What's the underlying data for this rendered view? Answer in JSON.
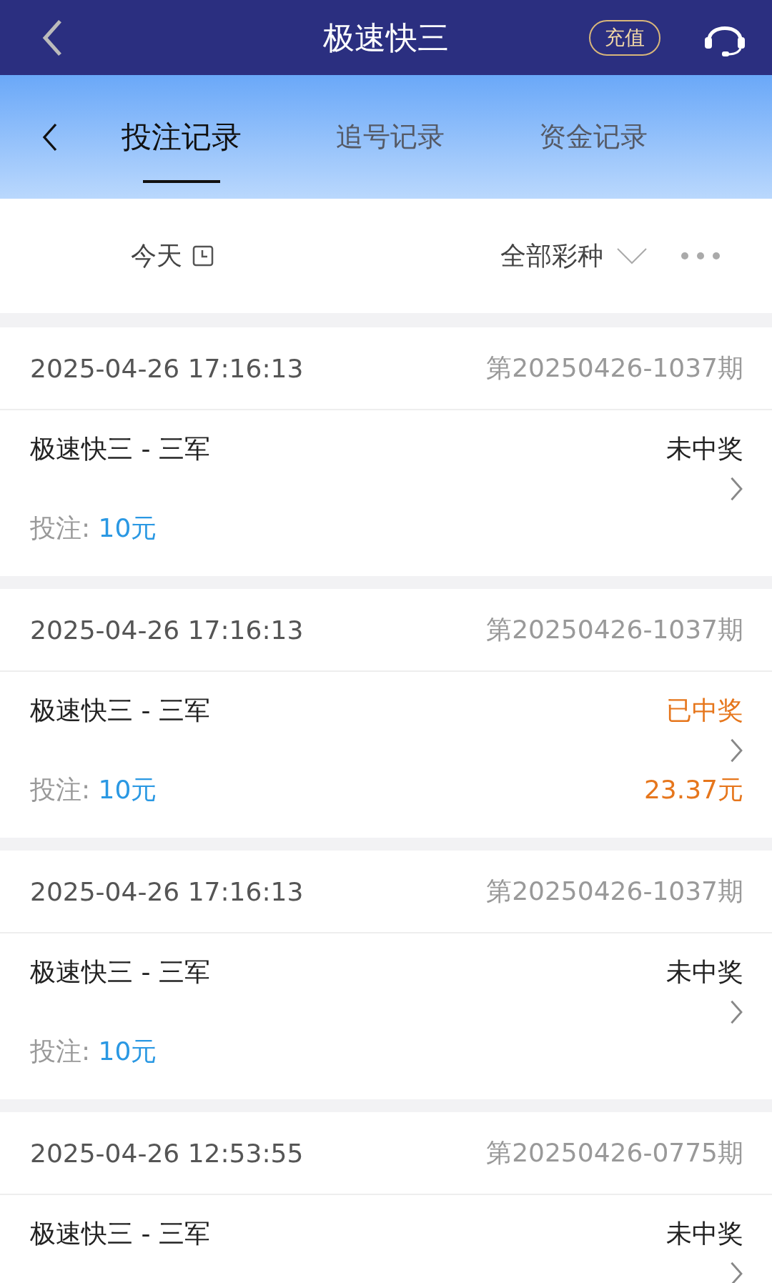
{
  "header": {
    "title": "极速快三",
    "recharge": "充值"
  },
  "tabs": [
    {
      "label": "投注记录",
      "selected": true
    },
    {
      "label": "追号记录",
      "selected": false
    },
    {
      "label": "资金记录",
      "selected": false
    }
  ],
  "filters": {
    "date": "今天",
    "lottery": "全部彩种"
  },
  "records": [
    {
      "time": "2025-04-26 17:16:13",
      "issue": "第20250426-1037期",
      "game": "极速快三 - 三军",
      "status": "未中奖",
      "won": false,
      "bet_label": "投注:",
      "bet_amount": "10元"
    },
    {
      "time": "2025-04-26 17:16:13",
      "issue": "第20250426-1037期",
      "game": "极速快三 - 三军",
      "status": "已中奖",
      "won": true,
      "bet_label": "投注:",
      "bet_amount": "10元",
      "payout": "23.37元"
    },
    {
      "time": "2025-04-26 17:16:13",
      "issue": "第20250426-1037期",
      "game": "极速快三 - 三军",
      "status": "未中奖",
      "won": false,
      "bet_label": "投注:",
      "bet_amount": "10元"
    },
    {
      "time": "2025-04-26 12:53:55",
      "issue": "第20250426-0775期",
      "game": "极速快三 - 三军",
      "status": "未中奖",
      "won": false
    }
  ]
}
